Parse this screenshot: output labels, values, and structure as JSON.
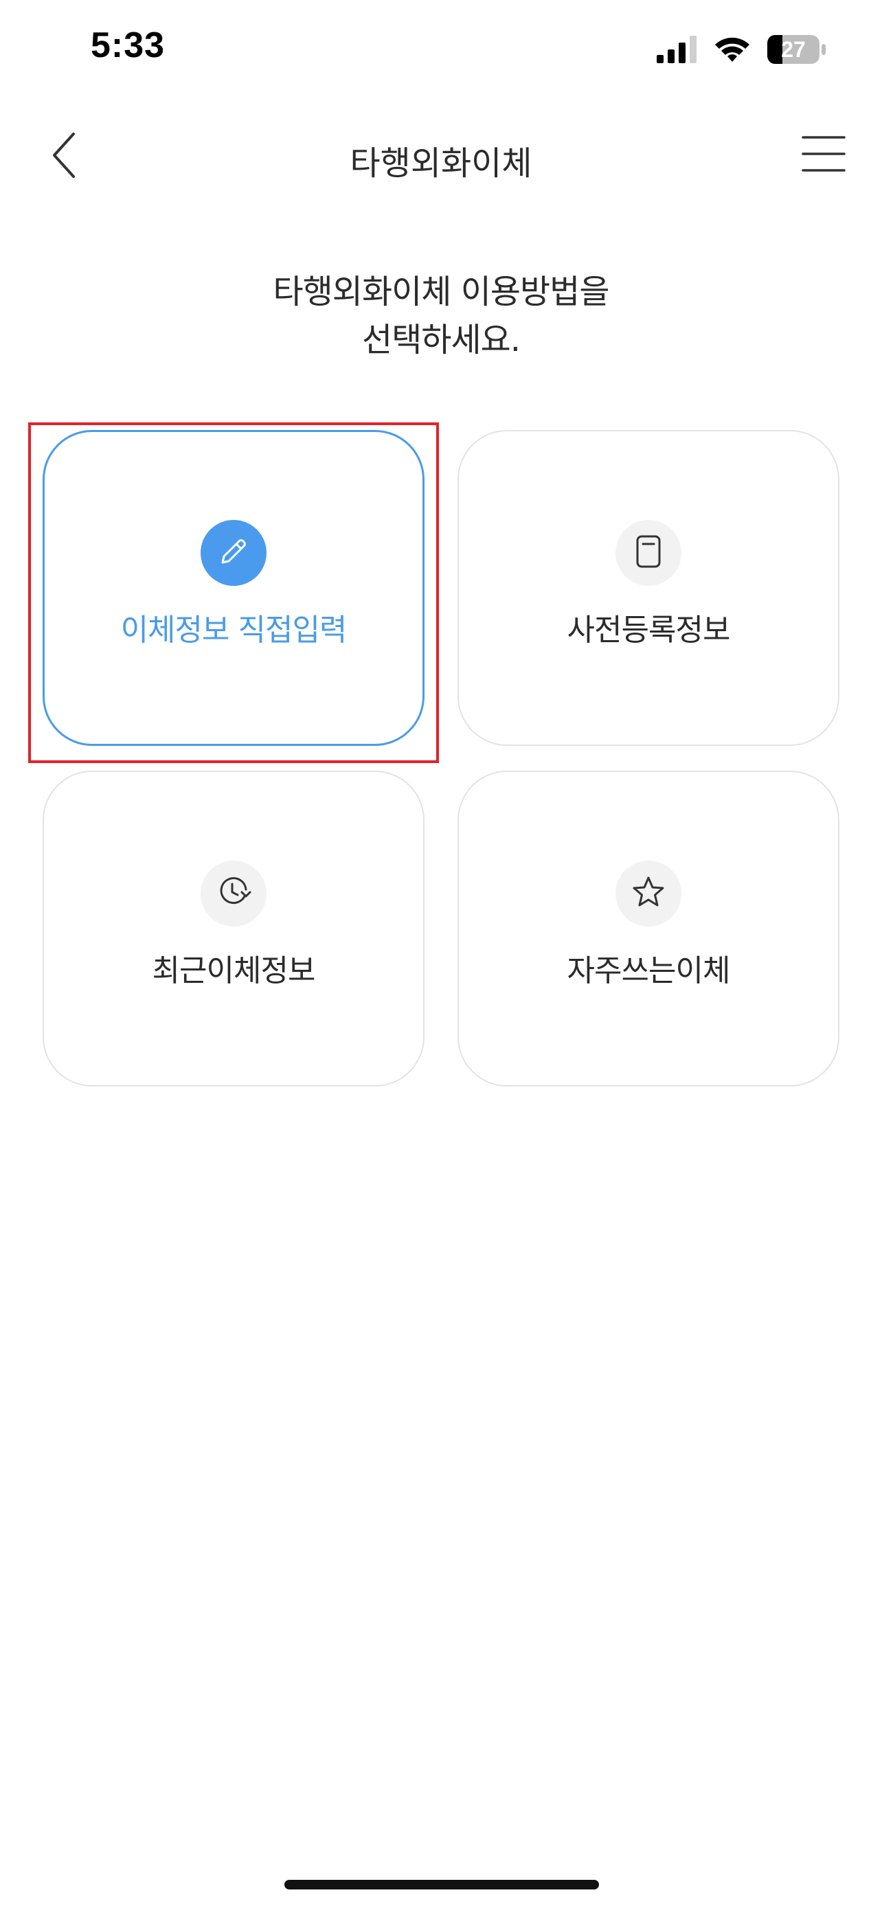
{
  "status_bar": {
    "time": "5:33",
    "battery": "27",
    "icons": [
      "signal-icon",
      "wifi-icon",
      "battery-icon"
    ]
  },
  "nav": {
    "title": "타행외화이체",
    "back_icon": "chevron-left-icon",
    "menu_icon": "hamburger-menu-icon"
  },
  "heading": {
    "line1": "타행외화이체 이용방법을",
    "line2": "선택하세요."
  },
  "options": [
    {
      "label": "이체정보 직접입력",
      "icon": "pencil-icon",
      "selected": true
    },
    {
      "label": "사전등록정보",
      "icon": "document-icon",
      "selected": false
    },
    {
      "label": "최근이체정보",
      "icon": "history-clock-icon",
      "selected": false
    },
    {
      "label": "자주쓰는이체",
      "icon": "star-icon",
      "selected": false
    }
  ],
  "colors": {
    "accent": "#4a9be8",
    "highlight": "#e3222b",
    "card_border": "#e3e3e3",
    "icon_bg": "#f2f2f2"
  }
}
